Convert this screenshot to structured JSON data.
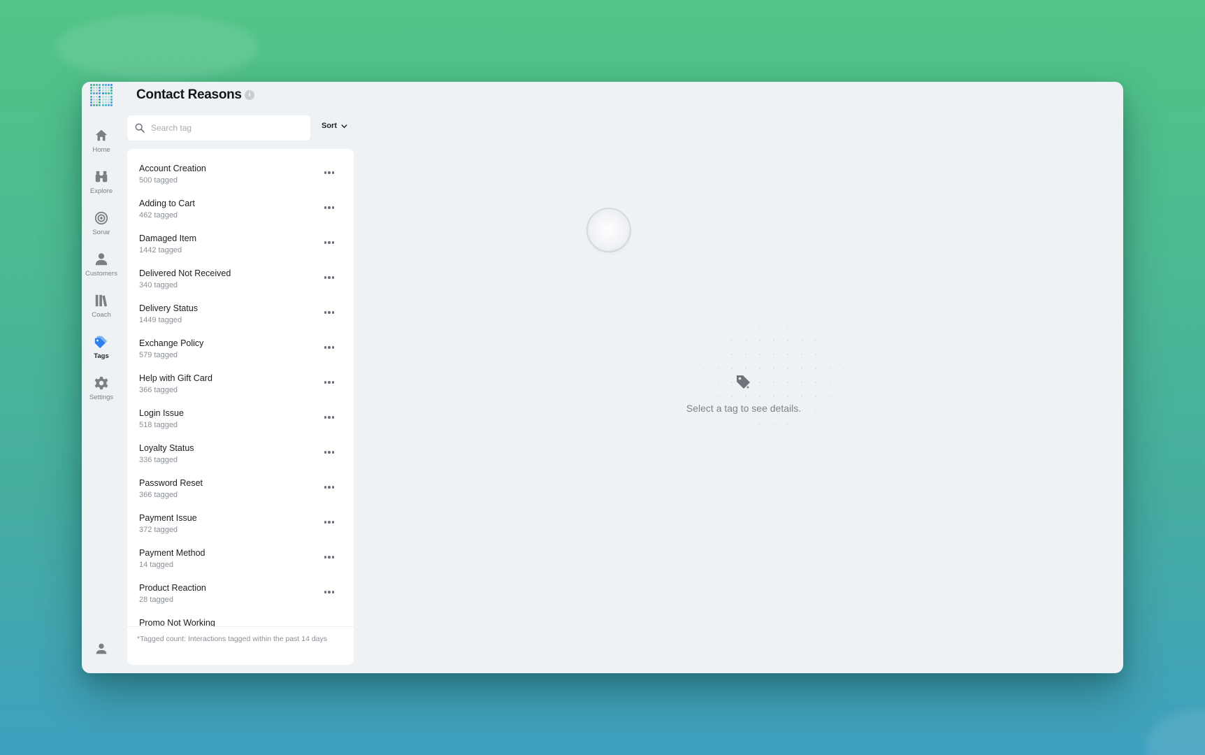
{
  "header": {
    "title": "Contact Reasons",
    "info_symbol": "i"
  },
  "nav": [
    {
      "label": "Home",
      "icon": "home-icon"
    },
    {
      "label": "Explore",
      "icon": "binoculars-icon"
    },
    {
      "label": "Sonar",
      "icon": "target-icon"
    },
    {
      "label": "Customers",
      "icon": "person-icon"
    },
    {
      "label": "Coach",
      "icon": "library-icon"
    },
    {
      "label": "Tags",
      "icon": "tag-icon",
      "active": true
    },
    {
      "label": "Settings",
      "icon": "gear-icon"
    }
  ],
  "search": {
    "placeholder": "Search tag",
    "value": ""
  },
  "sort": {
    "label": "Sort"
  },
  "tags": [
    {
      "name": "Account Creation",
      "count": "500 tagged"
    },
    {
      "name": "Adding to Cart",
      "count": "462 tagged"
    },
    {
      "name": "Damaged Item",
      "count": "1442 tagged"
    },
    {
      "name": "Delivered Not Received",
      "count": "340 tagged"
    },
    {
      "name": "Delivery Status",
      "count": "1449 tagged"
    },
    {
      "name": "Exchange Policy",
      "count": "579 tagged"
    },
    {
      "name": "Help with Gift Card",
      "count": "366 tagged"
    },
    {
      "name": "Login Issue",
      "count": "518 tagged"
    },
    {
      "name": "Loyalty Status",
      "count": "336 tagged"
    },
    {
      "name": "Password Reset",
      "count": "366 tagged"
    },
    {
      "name": "Payment Issue",
      "count": "372 tagged"
    },
    {
      "name": "Payment Method",
      "count": "14 tagged"
    },
    {
      "name": "Product Reaction",
      "count": "28 tagged"
    },
    {
      "name": "Promo Not Working",
      "count": ""
    }
  ],
  "footer_note": "*Tagged count: Interactions tagged within the past 14 days",
  "empty_state": {
    "text": "Select a tag to see details.",
    "icon": "tag-sparkle-icon"
  },
  "colors": {
    "accent": "#2f80ed",
    "window_bg": "#eff2f5",
    "panel_bg": "#ffffff",
    "icon_gray": "#7a7f86"
  }
}
